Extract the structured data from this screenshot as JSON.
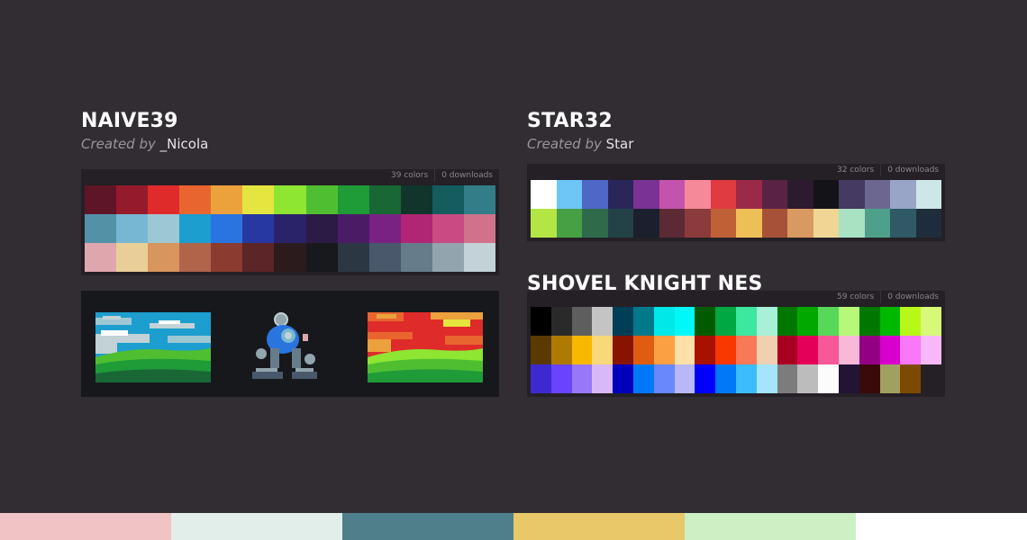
{
  "palettes": [
    {
      "name": "NAIVE39",
      "created_by": "Created by",
      "author": "_Nicola",
      "colors_count": "39 colors",
      "downloads": "0 downloads",
      "swatches": [
        "#5e1526",
        "#951a2c",
        "#e02b2b",
        "#e9652f",
        "#eba13c",
        "#e5e53f",
        "#8ee632",
        "#4fbf31",
        "#1f9b38",
        "#186735",
        "#11352b",
        "#145c5e",
        "#327d88",
        "#5391a7",
        "#78b7d3",
        "#9dc7d2",
        "#1c9ecf",
        "#2a74df",
        "#2738a2",
        "#2b236a",
        "#2c1b45",
        "#4a1c66",
        "#7a2284",
        "#b02674",
        "#c94b84",
        "#d0738a",
        "#e0a6ae",
        "#e9cf97",
        "#d8955e",
        "#b0654a",
        "#8b3b2f",
        "#5c2527",
        "#2c1b1d",
        "#18191d",
        "#2c3744",
        "#49586a",
        "#677c8b",
        "#92a5ae",
        "#c2d2d6"
      ]
    },
    {
      "name": "STAR32",
      "created_by": "Created by",
      "author": "Star",
      "colors_count": "32 colors",
      "downloads": "0 downloads",
      "swatches": [
        "#ffffff",
        "#6dc6f6",
        "#4f67c6",
        "#2a265a",
        "#7a3294",
        "#c453ad",
        "#f5899a",
        "#df3b40",
        "#9a2a48",
        "#5a2345",
        "#2c1b2f",
        "#141418",
        "#453a61",
        "#6c6791",
        "#98a5c7",
        "#cde6e7",
        "#b3e545",
        "#47a044",
        "#2f6b4b",
        "#234146",
        "#1c1f2e",
        "#5b2a35",
        "#8b3b3b",
        "#c06036",
        "#efbf57",
        "#a75238",
        "#d99a61",
        "#f0d595",
        "#a8e1c3",
        "#4ea08a",
        "#2f5965",
        "#1f2c3b"
      ]
    },
    {
      "name": "SHOVEL KNIGHT NES",
      "created_by": "",
      "author": "",
      "colors_count": "59 colors",
      "downloads": "0 downloads",
      "swatches": [
        "#000000",
        "#2a2a2a",
        "#5e5e5e",
        "#c4c4c4",
        "#003e55",
        "#007a8a",
        "#00e8e8",
        "#00f8f8",
        "#005a00",
        "#00a844",
        "#3ce8a0",
        "#a8f0d8",
        "#007800",
        "#00a800",
        "#58d858",
        "#b8f878",
        "#007800",
        "#00b800",
        "#b8f818",
        "#d8f878",
        "#5a3a00",
        "#b07a00",
        "#f8b800",
        "#f8d878",
        "#881400",
        "#e05c10",
        "#fca044",
        "#fce0a8",
        "#a81000",
        "#f83800",
        "#f87858",
        "#f0d0b0",
        "#a80020",
        "#e40058",
        "#f85898",
        "#f8b8d8",
        "#940084",
        "#d800cc",
        "#f878f8",
        "#f8b8f8",
        "#3c2ad0",
        "#6844fc",
        "#9878f8",
        "#d8b8f8",
        "#0000bc",
        "#0078f8",
        "#6888fc",
        "#b8b8f8",
        "#0000fc",
        "#0078f8",
        "#3cbcfc",
        "#a4e4fc",
        "#7c7c7c",
        "#bcbcbc",
        "#fcfcfc",
        "#231335",
        "#3a0a0a",
        "#a0a060",
        "#7c4a00"
      ]
    }
  ],
  "preview": {
    "scene_left": "sky-landscape",
    "robot": "robot-sprite",
    "scene_right": "sunset-landscape"
  },
  "footer_strip": [
    "#f0c4c4",
    "#e2eeea",
    "#4e7f8a",
    "#e8c868",
    "#ccf0c4",
    "#ffffff"
  ]
}
